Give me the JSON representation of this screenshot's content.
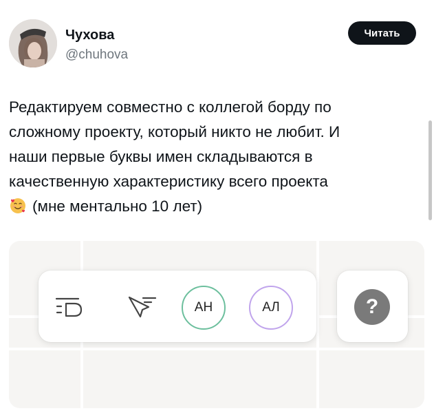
{
  "tweet": {
    "author_name": "Чухова",
    "author_handle": "@chuhova",
    "follow_label": "Читать",
    "text_lines": [
      "Редактируем совместно с коллегой борду по",
      "сложному проекту, который никто не любит. И",
      "наши первые буквы имен складываются в",
      "качественную характеристику всего проекта"
    ],
    "text_last_line": "(мне ментально 10 лет)",
    "emoji_name": "smiling-face-with-hearts-emoji"
  },
  "board": {
    "toolbar": {
      "tools": [
        {
          "name": "text-tool-icon"
        },
        {
          "name": "pointer-tool-icon"
        }
      ],
      "users": [
        {
          "initials": "АН",
          "color": "#6cbf9d"
        },
        {
          "initials": "АЛ",
          "color": "#c0a4ec"
        }
      ]
    },
    "help": {
      "label": "?",
      "color": "#7a7a7a"
    }
  }
}
